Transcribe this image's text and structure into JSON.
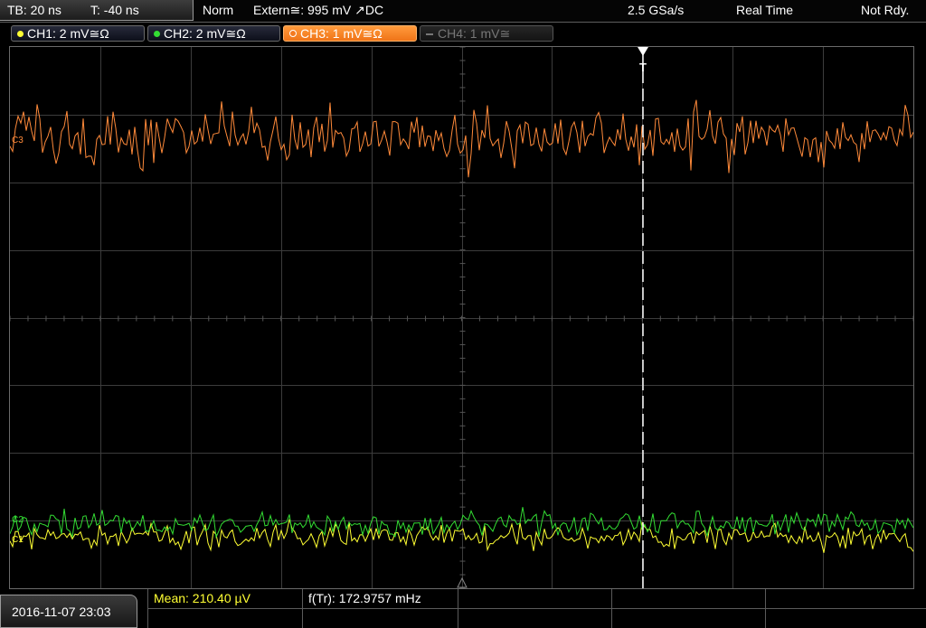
{
  "topbar": {
    "timebase": "TB: 20 ns",
    "trigger_time": "T: -40 ns",
    "mode": "Norm",
    "trigger_source": "Extern≅: 995 mV ↗DC",
    "sample_rate": "2.5 GSa/s",
    "acq_mode": "Real Time",
    "status": "Not Rdy."
  },
  "channels": [
    {
      "label": "CH1: 2 mV≅Ω",
      "color": "#ffff33",
      "state": "on"
    },
    {
      "label": "CH2: 2 mV≅Ω",
      "color": "#33dd33",
      "state": "on"
    },
    {
      "label": "CH3: 1 mV≅Ω",
      "color": "#ff8a3a",
      "state": "active"
    },
    {
      "label": "CH4: 1 mV≅",
      "color": "#777777",
      "state": "off"
    }
  ],
  "waveform_markers": {
    "ch3": "C3",
    "ch2": "C2",
    "ch1": "C1",
    "trigger": "T"
  },
  "bottombar": {
    "datetime": "2016-11-07 23:03",
    "measurement1": "Mean: 210.40 µV",
    "measurement2": "f(Tr): 172.9757 mHz",
    "measurement1_color": "#ffff33"
  },
  "colors": {
    "ch1": "#ffff33",
    "ch2": "#33dd33",
    "ch3": "#ff8a3a",
    "grid": "#3c3c3c",
    "trigger_line": "#ffffff"
  }
}
